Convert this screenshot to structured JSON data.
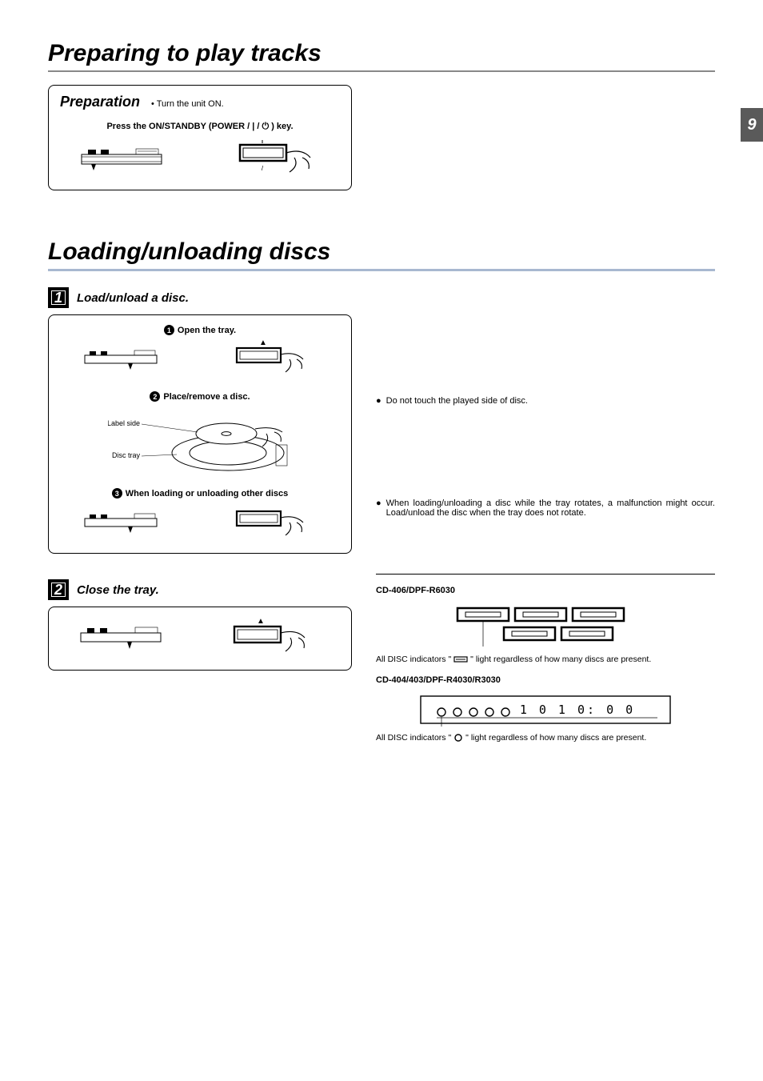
{
  "page_number": "9",
  "section1_title": "Preparing to play tracks",
  "prep": {
    "label": "Preparation",
    "bullet": "• Turn the unit ON.",
    "line": "Press the ON/STANDBY (POWER / | / ⏻ ) key."
  },
  "section2_title": "Loading/unloading discs",
  "step1": {
    "num": "1",
    "title": "Load/unload a disc.",
    "sub1": "Open the tray.",
    "sub1_num": "1",
    "sub2": "Place/remove a disc.",
    "sub2_num": "2",
    "sub2_label1": "Label side",
    "sub2_label2": "Disc tray",
    "sub3": "When loading or unloading other discs",
    "sub3_num": "3"
  },
  "note1": "Do not touch the played side of disc.",
  "note2": "When loading/unloading a disc while the tray rotates, a malfunction might occur. Load/unload the disc when the tray does not rotate.",
  "step2": {
    "num": "2",
    "title": "Close the tray."
  },
  "model1": {
    "head": "CD-406/DPF-R6030",
    "caption_pre": "All DISC indicators \"",
    "caption_post": "\" light regardless of how many discs are present."
  },
  "model2": {
    "head": "CD-404/403/DPF-R4030/R3030",
    "display_seg": "1 0 1     0: 0 0",
    "caption_pre": "All DISC indicators \"",
    "caption_post": "\" light regardless of how many discs are present."
  }
}
